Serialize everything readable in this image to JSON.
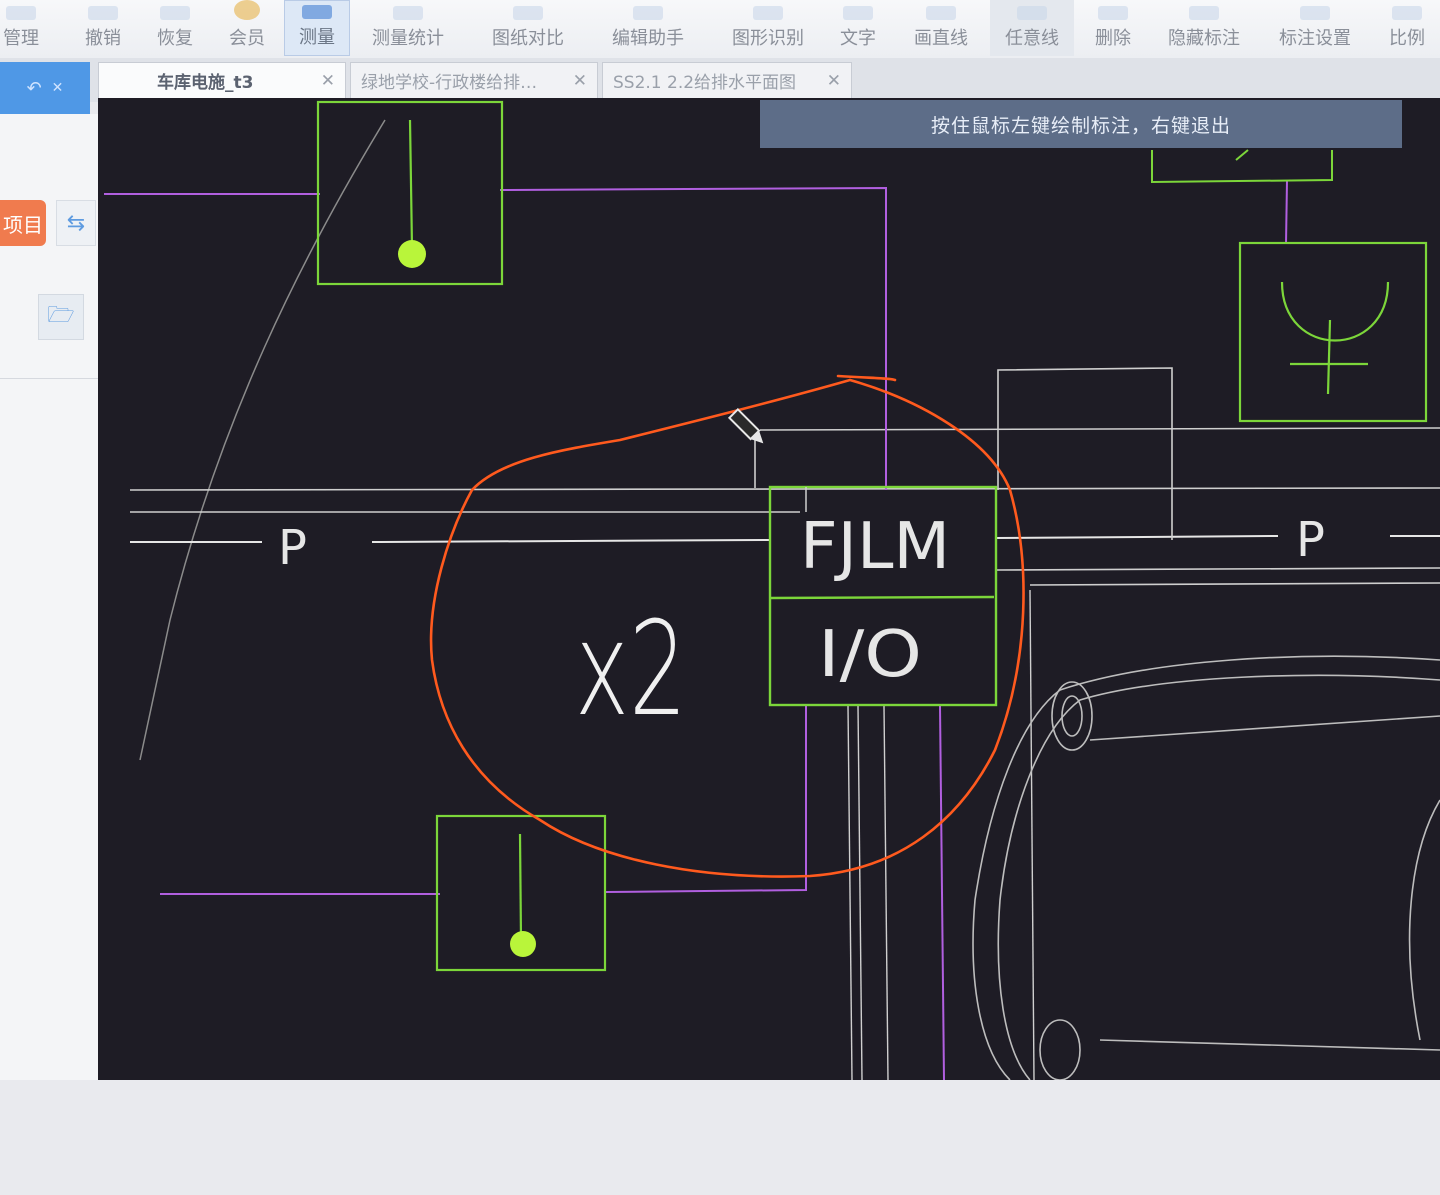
{
  "toolbar": {
    "items": [
      {
        "label": "管理",
        "active": false
      },
      {
        "label": "撤销",
        "active": false
      },
      {
        "label": "恢复",
        "active": false
      },
      {
        "label": "会员",
        "active": false
      },
      {
        "label": "测量",
        "active": true
      },
      {
        "label": "测量统计",
        "active": false
      },
      {
        "label": "图纸对比",
        "active": false
      },
      {
        "label": "编辑助手",
        "active": false
      },
      {
        "label": "图形识别",
        "active": false
      },
      {
        "label": "文字",
        "active": false
      },
      {
        "label": "画直线",
        "active": false
      },
      {
        "label": "任意线",
        "active": false
      },
      {
        "label": "删除",
        "active": false
      },
      {
        "label": "隐藏标注",
        "active": false
      },
      {
        "label": "标注设置",
        "active": false
      },
      {
        "label": "比例",
        "active": false
      }
    ]
  },
  "tabs": [
    {
      "label": "车库电施_t3",
      "active": true
    },
    {
      "label": "绿地学校-行政楼给排…",
      "active": false
    },
    {
      "label": "SS2.1 2.2给排水平面图",
      "active": false
    }
  ],
  "sidebar": {
    "project_label": "项目"
  },
  "canvas": {
    "hint": "按住鼠标左键绘制标注，右键退出",
    "labels": {
      "pipe_left": "P",
      "pipe_right": "P",
      "annotation": "x2",
      "box_top": "FJLM",
      "box_bottom": "I/O"
    },
    "colors": {
      "background": "#1e1c25",
      "green": "#7cd63a",
      "purple": "#b15fe0",
      "white": "#e6e6e6",
      "markup": "#ff5a1e"
    }
  }
}
